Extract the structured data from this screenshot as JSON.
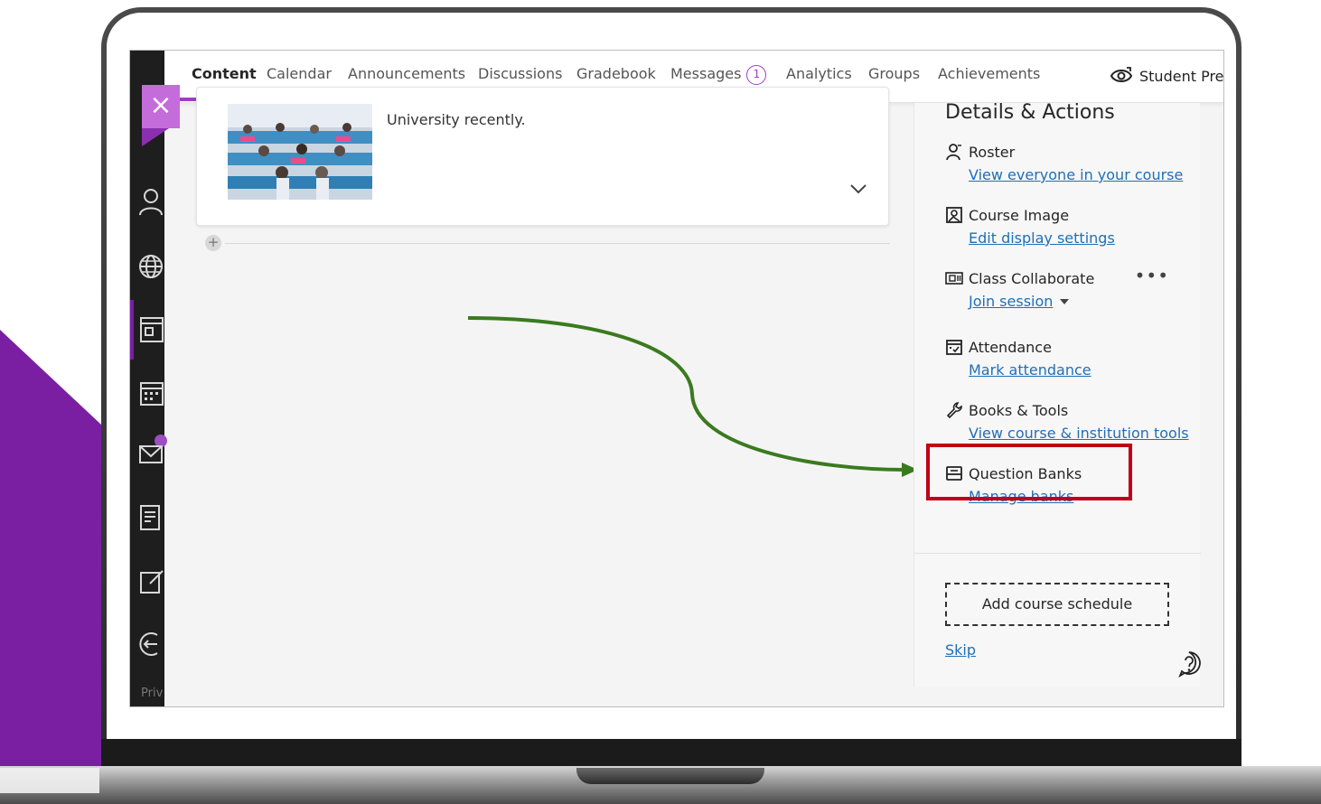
{
  "tabs": [
    {
      "label": "Content",
      "active": true
    },
    {
      "label": "Calendar"
    },
    {
      "label": "Announcements"
    },
    {
      "label": "Discussions"
    },
    {
      "label": "Gradebook"
    },
    {
      "label": "Messages",
      "count": "1"
    },
    {
      "label": "Analytics"
    },
    {
      "label": "Groups"
    },
    {
      "label": "Achievements"
    }
  ],
  "student_preview_label": "Student Preview",
  "close_icon": "×",
  "card": {
    "text": "University recently."
  },
  "add_icon": "+",
  "panel": {
    "title": "Details & Actions",
    "items": [
      {
        "title": "Roster",
        "link": "View everyone in your course",
        "icon": "roster-icon"
      },
      {
        "title": "Course Image",
        "link": "Edit display settings",
        "icon": "image-icon"
      },
      {
        "title": "Class Collaborate",
        "link": "Join session",
        "icon": "collaborate-icon",
        "more": "•••"
      },
      {
        "title": "Attendance",
        "link": "Mark attendance",
        "icon": "attendance-icon"
      },
      {
        "title": "Books & Tools",
        "link": "View course & institution tools",
        "icon": "wrench-icon"
      },
      {
        "title": "Question Banks",
        "link": "Manage banks",
        "icon": "question-bank-icon"
      }
    ],
    "schedule_button": "Add course schedule",
    "skip_link": "Skip"
  },
  "rail": {
    "footer_text": "Priv"
  },
  "colors": {
    "accent_purple": "#9b3fc2",
    "link_blue": "#1f6fb8",
    "highlight_red": "#c00016",
    "arrow_green": "#3a7a1f"
  }
}
